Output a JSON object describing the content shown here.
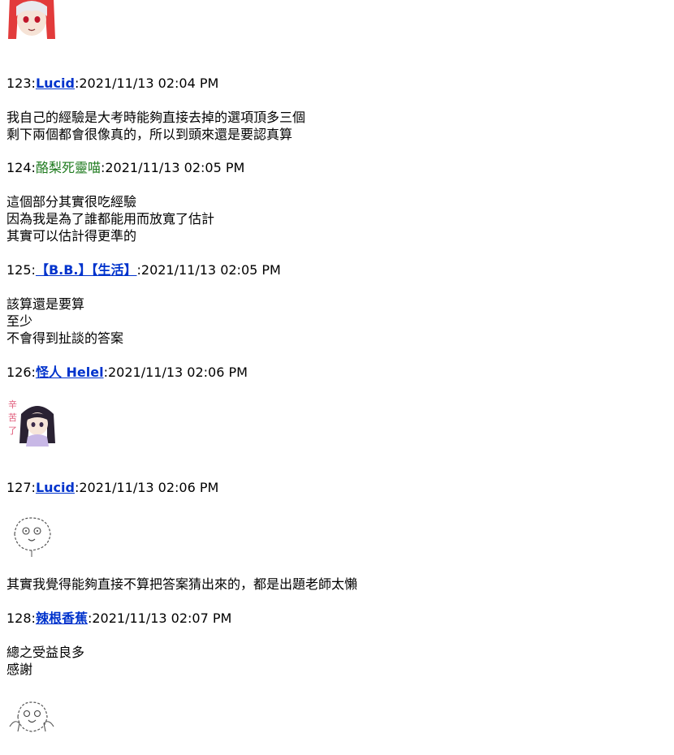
{
  "posts": [
    {
      "number": "123",
      "name": "Lucid",
      "datetime": "2021/11/13 02:04 PM",
      "lines": [
        "我自己的經驗是大考時能夠直接去掉的選項頂多三個",
        "剩下兩個都會很像真的，所以到頭來還是要認真算"
      ]
    },
    {
      "number": "124",
      "name": "酪梨死靈喵",
      "datetime": "2021/11/13 02:05 PM",
      "lines": [
        "這個部分其實很吃經驗",
        "因為我是為了誰都能用而放寬了估計",
        "其實可以估計得更準的"
      ]
    },
    {
      "number": "125",
      "name": "【B.B.】【生活】",
      "datetime": "2021/11/13 02:05 PM",
      "lines": [
        "該算還是要算",
        "至少",
        "不會得到扯談的答案"
      ]
    },
    {
      "number": "126",
      "name": "怪人 Helel",
      "datetime": "2021/11/13 02:06 PM",
      "lines": []
    },
    {
      "number": "127",
      "name": "Lucid",
      "datetime": "2021/11/13 02:06 PM",
      "lines": [
        "其實我覺得能夠直接不算把答案猜出來的，都是出題老師太懶"
      ]
    },
    {
      "number": "128",
      "name": "辣根香蕉",
      "datetime": "2021/11/13 02:07 PM",
      "lines": [
        "總之受益良多",
        "感謝"
      ]
    }
  ],
  "separator": ":"
}
